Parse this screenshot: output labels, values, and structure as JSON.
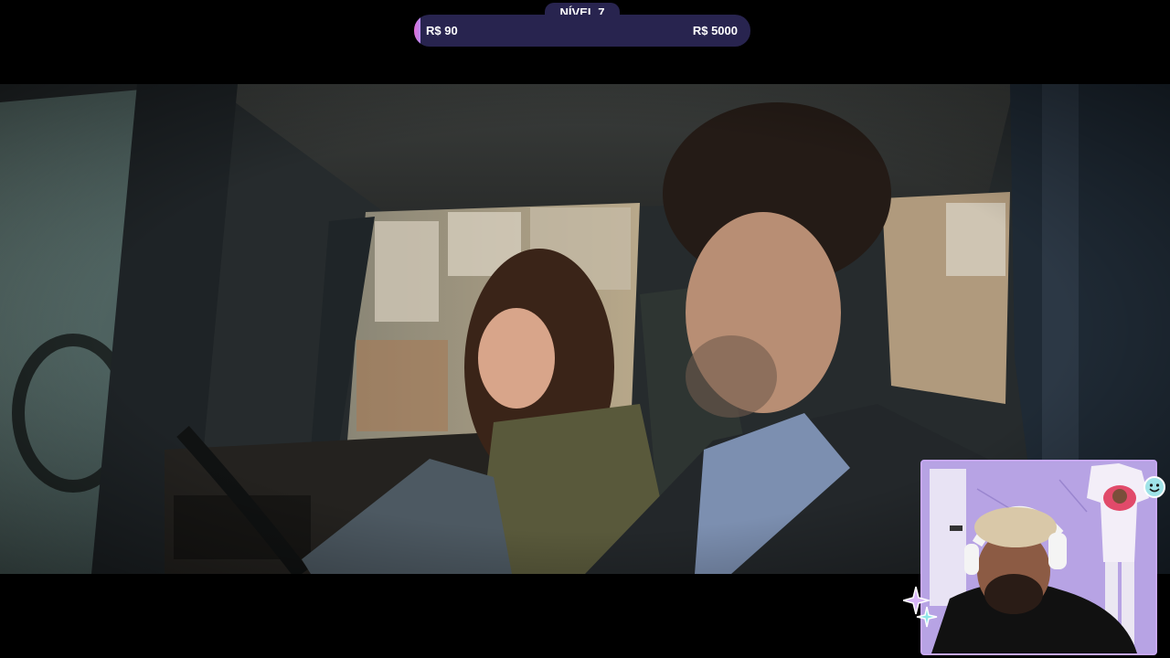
{
  "goal": {
    "level_label": "NÍVEL 7",
    "start_label": "R$ 90",
    "end_label": "R$ 5000",
    "progress_fraction": 0.018,
    "colors": {
      "bar_bg": "#28244f",
      "fill": "#e16bd4"
    }
  },
  "video": {
    "scene": "movie-scene-car-interior"
  },
  "webcam": {
    "frame_color": "#c7a8f5"
  },
  "icons": {
    "sparkle": "sparkle-icon",
    "smiley": "smiley-badge-icon"
  }
}
